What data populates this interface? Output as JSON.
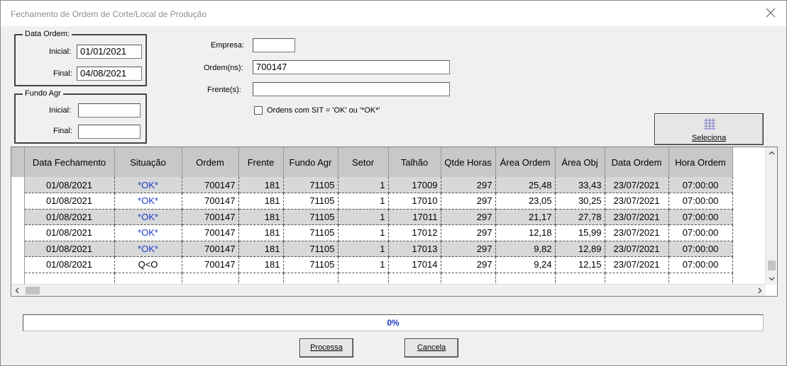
{
  "window": {
    "title": "Fechamento de Ordem de Corte/Local de Produção"
  },
  "data_ordem": {
    "group_label": "Data Ordem:",
    "inicial_label": "Inicial:",
    "inicial_value": "01/01/2021",
    "final_label": "Final:",
    "final_value": "04/08/2021"
  },
  "fundo_agr": {
    "group_label": "Fundo Agr",
    "inicial_label": "Inicial:",
    "inicial_value": "",
    "final_label": "Final:",
    "final_value": ""
  },
  "form": {
    "empresa_label": "Empresa:",
    "empresa_value": "",
    "ordens_label": "Ordem(ns):",
    "ordens_value": "700147",
    "frentes_label": "Frente(s):",
    "frentes_value": "",
    "checkbox_label": "Ordens com SIT = 'OK' ou '*OK*'",
    "checkbox_checked": false
  },
  "seleciona_button": {
    "icon": "grid-icon",
    "label": "Seleciona"
  },
  "grid": {
    "columns": [
      "Data Fechamento",
      "Situação",
      "Ordem",
      "Frente",
      "Fundo Agr",
      "Setor",
      "Talhão",
      "Qtde Horas",
      "Área Ordem",
      "Área Obj",
      "Data Ordem",
      "Hora Ordem"
    ],
    "rows": [
      [
        "01/08/2021",
        "*OK*",
        "700147",
        "181",
        "71105",
        "1",
        "17009",
        "297",
        "25,48",
        "33,43",
        "23/07/2021",
        "07:00:00"
      ],
      [
        "01/08/2021",
        "*OK*",
        "700147",
        "181",
        "71105",
        "1",
        "17010",
        "297",
        "23,05",
        "30,25",
        "23/07/2021",
        "07:00:00"
      ],
      [
        "01/08/2021",
        "*OK*",
        "700147",
        "181",
        "71105",
        "1",
        "17011",
        "297",
        "21,17",
        "27,78",
        "23/07/2021",
        "07:00:00"
      ],
      [
        "01/08/2021",
        "*OK*",
        "700147",
        "181",
        "71105",
        "1",
        "17012",
        "297",
        "12,18",
        "15,99",
        "23/07/2021",
        "07:00:00"
      ],
      [
        "01/08/2021",
        "*OK*",
        "700147",
        "181",
        "71105",
        "1",
        "17013",
        "297",
        "9,82",
        "12,89",
        "23/07/2021",
        "07:00:00"
      ],
      [
        "01/08/2021",
        "Q<O",
        "700147",
        "181",
        "71105",
        "1",
        "17014",
        "297",
        "9,24",
        "12,15",
        "23/07/2021",
        "07:00:00"
      ]
    ]
  },
  "progress": {
    "text": "0%",
    "value": 0
  },
  "buttons": {
    "processa_label": "Processa",
    "cancela_label": "Cancela"
  },
  "colors": {
    "status_ok": "#1a3ccc",
    "progress_text": "#1a3ccc"
  }
}
